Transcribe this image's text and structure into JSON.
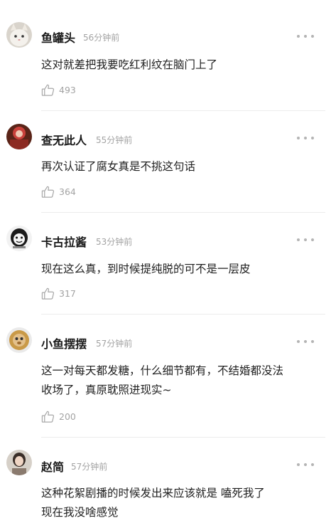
{
  "comments": [
    {
      "username": "鱼罐头",
      "time": "56分钟前",
      "content": "这对就差把我要吃红利纹在脑门上了",
      "likes": "493"
    },
    {
      "username": "查无此人",
      "time": "55分钟前",
      "content": "再次认证了腐女真是不挑这句话",
      "likes": "364"
    },
    {
      "username": "卡古拉酱",
      "time": "53分钟前",
      "content": "现在这么真，到时候提纯脱的可不是一层皮",
      "likes": "317"
    },
    {
      "username": "小鱼摆摆",
      "time": "57分钟前",
      "content": "这一对每天都发糖，什么细节都有，不结婚都没法\n收场了，真原耽照进现实~",
      "likes": "200"
    },
    {
      "username": "赵简",
      "time": "57分钟前",
      "content": "这种花絮剧播的时候发出来应该就是   嗑死我了\n现在我没啥感觉",
      "likes": ""
    }
  ],
  "icons": {
    "more": "more-dots-icon",
    "like": "thumbs-up-icon"
  },
  "colors": {
    "username": "#1a1a1a",
    "meta": "#a3a3a3",
    "divider": "#ececec"
  }
}
